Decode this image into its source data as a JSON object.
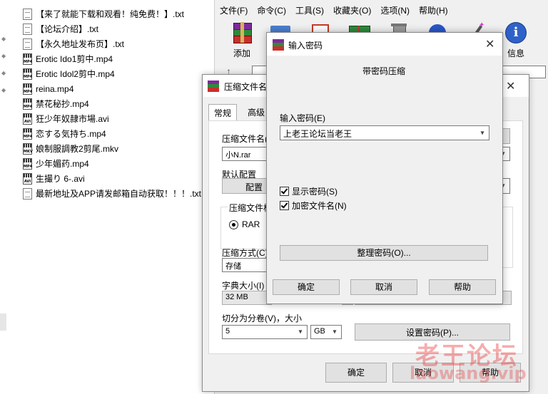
{
  "file_list": [
    {
      "name": "【来了就能下载和观看！纯免费！】.txt",
      "type": "txt"
    },
    {
      "name": "【论坛介绍】.txt",
      "type": "txt"
    },
    {
      "name": "【永久地址发布页】.txt",
      "type": "txt"
    },
    {
      "name": "Erotic Ido1剪中.mp4",
      "type": "video",
      "ext": "MP4"
    },
    {
      "name": "Erotic Idol2剪中.mp4",
      "type": "video",
      "ext": "MP4"
    },
    {
      "name": "reina.mp4",
      "type": "video",
      "ext": "MP4"
    },
    {
      "name": "禁花秘抄.mp4",
      "type": "video",
      "ext": "MP4"
    },
    {
      "name": "狂少年奴隷市場.avi",
      "type": "video",
      "ext": "AVI"
    },
    {
      "name": "恋する気持ち.mp4",
      "type": "video",
      "ext": "MP4"
    },
    {
      "name": "娘制服調教2剪尾.mkv",
      "type": "video",
      "ext": "MKV"
    },
    {
      "name": "少年媚药.mp4",
      "type": "video",
      "ext": "MP4"
    },
    {
      "name": "生撮り 6-.avi",
      "type": "video",
      "ext": "AVI"
    },
    {
      "name": "最新地址及APP请发邮箱自动获取！！！.txt",
      "type": "txt"
    }
  ],
  "winrar": {
    "menu": [
      "文件(F)",
      "命令(C)",
      "工具(S)",
      "收藏夹(O)",
      "选项(N)",
      "帮助(H)"
    ],
    "toolbar": {
      "add_label": "添加",
      "info_label": "信息"
    }
  },
  "archive_dialog": {
    "title": "压缩文件名",
    "tabs": [
      "常规",
      "高级"
    ],
    "archive_name_label": "压缩文件名(",
    "archive_name_value": "小N.rar",
    "default_profile_label": "默认配置",
    "profile_button": "配置",
    "format_label": "压缩文件格",
    "format_option": "RAR",
    "method_label": "压缩方式(C)",
    "method_value": "存储",
    "dict_label": "字典大小(I)",
    "dict_value": "32 MB",
    "split_label": "切分为分卷(V)，大小",
    "split_value": "5",
    "split_unit": "GB",
    "set_password_button": "设置密码(P)...",
    "ok_button": "确定",
    "cancel_button": "取消",
    "help_button": "帮助"
  },
  "password_dialog": {
    "title": "输入密码",
    "heading": "带密码压缩",
    "password_label": "输入密码(E)",
    "password_value": "上老王论坛当老王",
    "show_password_label": "显示密码(S)",
    "show_password_checked": true,
    "encrypt_names_label": "加密文件名(N)",
    "encrypt_names_checked": true,
    "organize_button": "整理密码(O)...",
    "ok_button": "确定",
    "cancel_button": "取消",
    "help_button": "帮助"
  },
  "watermark": {
    "main": "老王论坛",
    "sub": "laowang.vip"
  }
}
